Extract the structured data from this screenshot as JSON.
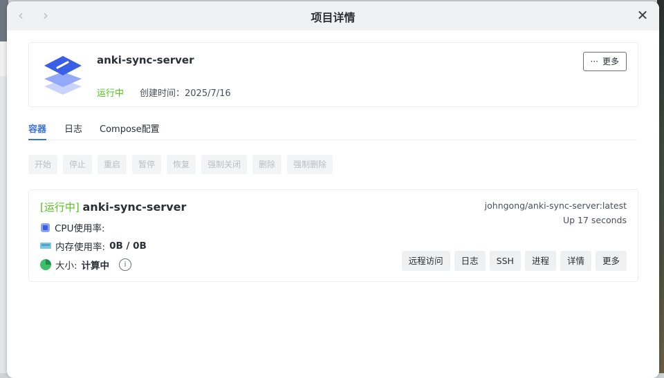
{
  "window": {
    "title": "项目详情",
    "back_icon": "‹",
    "forward_icon": "›",
    "close_icon": "✕"
  },
  "project": {
    "name": "anki-sync-server",
    "status": "运行中",
    "created": "创建时间：2025/7/16",
    "more_dots": "···",
    "more_label": "更多"
  },
  "tabs": [
    {
      "label": "容器",
      "active": true
    },
    {
      "label": "日志",
      "active": false
    },
    {
      "label": "Compose配置",
      "active": false
    }
  ],
  "actions": [
    "开始",
    "停止",
    "重启",
    "暂停",
    "恢复",
    "强制关闭",
    "删除",
    "强制删除"
  ],
  "container": {
    "status": "[运行中]",
    "name": "anki-sync-server",
    "image": "johngong/anki-sync-server:latest",
    "uptime": "Up 17 seconds",
    "cpu_label": "CPU使用率:",
    "mem_label": "内存使用率:",
    "mem_value": "0B / 0B",
    "size_label": "大小:",
    "size_value": "计算中",
    "info_glyph": "i",
    "buttons": [
      "远程访问",
      "日志",
      "SSH",
      "进程",
      "详情",
      "更多"
    ]
  },
  "colors": {
    "accent": "#3b6fe0",
    "running": "#52c41a"
  }
}
